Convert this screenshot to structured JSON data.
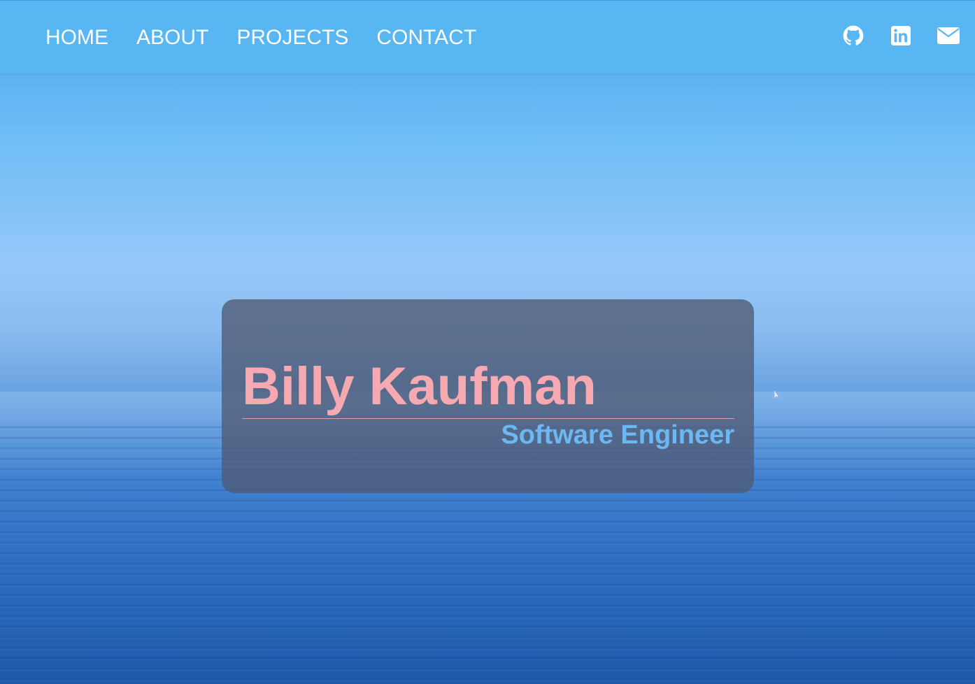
{
  "nav": {
    "links": [
      {
        "label": "HOME"
      },
      {
        "label": "ABOUT"
      },
      {
        "label": "PROJECTS"
      },
      {
        "label": "CONTACT"
      }
    ],
    "social": [
      {
        "icon": "github-icon"
      },
      {
        "icon": "linkedin-icon"
      },
      {
        "icon": "mail-icon"
      }
    ]
  },
  "hero": {
    "name": "Billy Kaufman",
    "title": "Software Engineer"
  },
  "colors": {
    "navbar": "#58b6f3",
    "name": "#f6a9b1",
    "title": "#6bb8f2",
    "card": "rgba(80, 90, 115, 0.78)"
  }
}
